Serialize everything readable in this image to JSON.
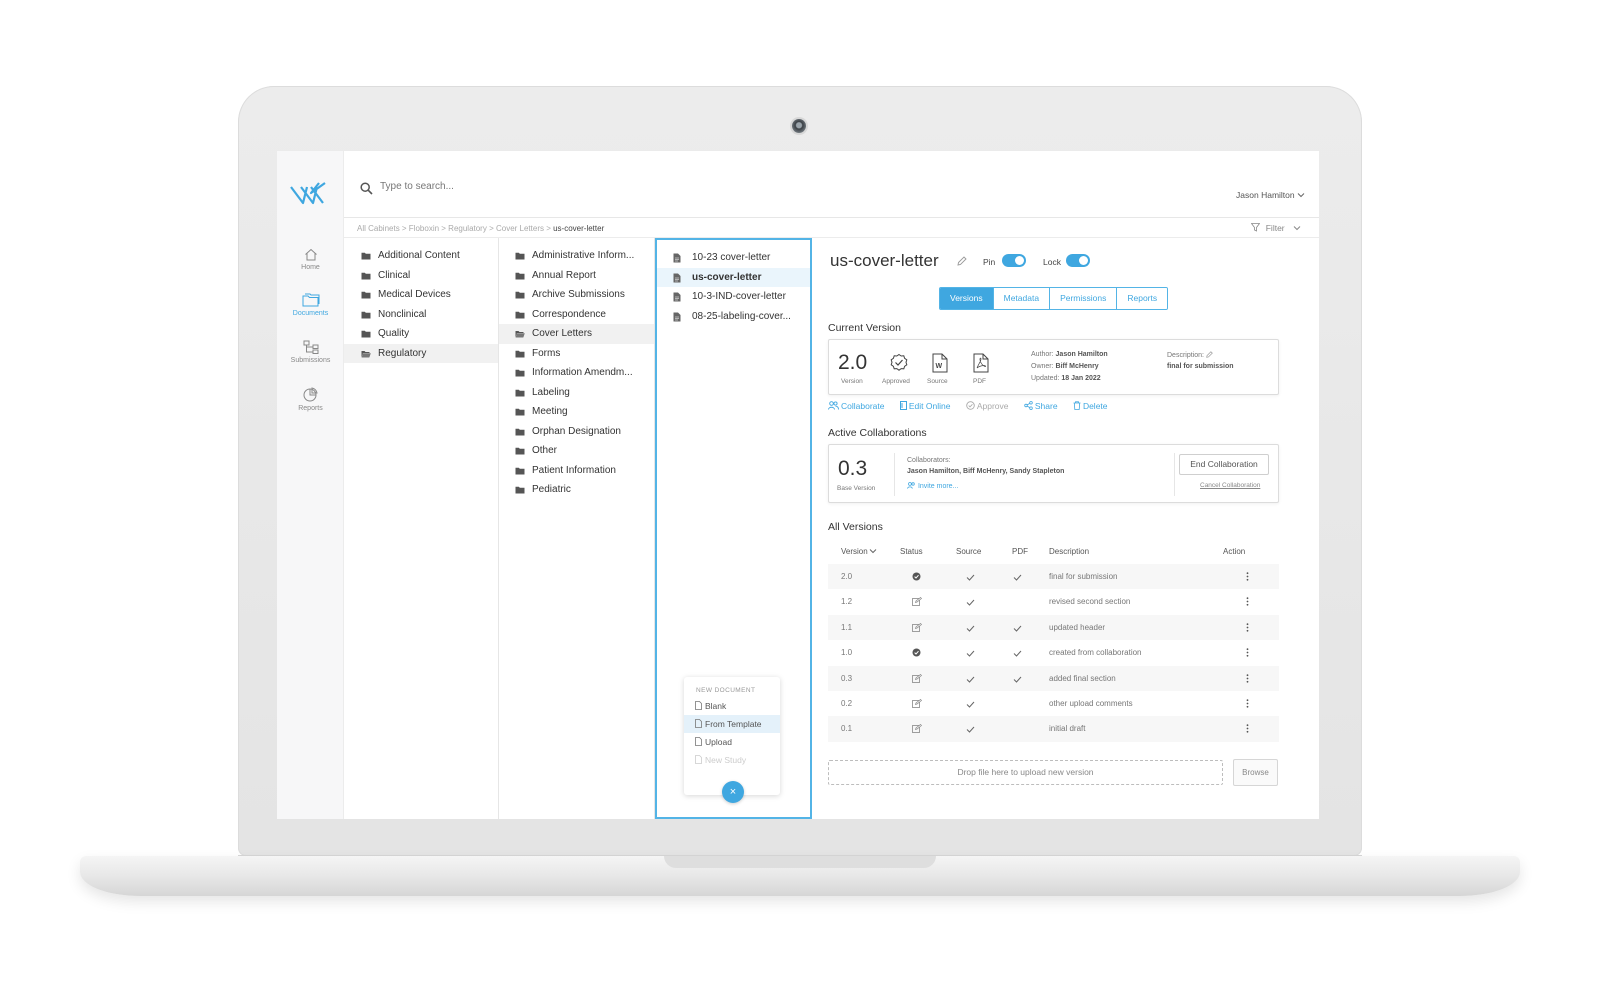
{
  "app": {
    "colors": {
      "accent": "#3fa7e0",
      "text": "#333333",
      "muted": "#888888"
    }
  },
  "nav": {
    "items": [
      {
        "label": "Home",
        "icon": "home-icon"
      },
      {
        "label": "Documents",
        "icon": "folder-icon",
        "active": true
      },
      {
        "label": "Submissions",
        "icon": "tree-icon"
      },
      {
        "label": "Reports",
        "icon": "pie-chart-icon"
      }
    ]
  },
  "search": {
    "placeholder": "Type to search..."
  },
  "user": {
    "name": "Jason Hamilton"
  },
  "breadcrumb": {
    "path": "All Cabinets > Floboxin > Regulatory > Cover Letters > ",
    "current": "us-cover-letter"
  },
  "filter": {
    "label": "Filter"
  },
  "cabinets": [
    "Additional Content",
    "Clinical",
    "Medical Devices",
    "Nonclinical",
    "Quality",
    "Regulatory"
  ],
  "subfolders": [
    "Administrative Inform...",
    "Annual Report",
    "Archive Submissions",
    "Correspondence",
    "Cover Letters",
    "Forms",
    "Information Amendm...",
    "Labeling",
    "Meeting",
    "Orphan Designation",
    "Other",
    "Patient Information",
    "Pediatric"
  ],
  "files": [
    "10-23 cover-letter",
    "us-cover-letter",
    "10-3-IND-cover-letter",
    "08-25-labeling-cover..."
  ],
  "new_document": {
    "header": "NEW DOCUMENT",
    "items": [
      "Blank",
      "From Template",
      "Upload",
      "New Study"
    ],
    "close": "×"
  },
  "detail": {
    "title": "us-cover-letter",
    "pin_label": "Pin",
    "lock_label": "Lock",
    "tabs": [
      "Versions",
      "Metadata",
      "Permissions",
      "Reports"
    ],
    "current_version": {
      "section_title": "Current Version",
      "version": "2.0",
      "version_caption": "Version",
      "approved_caption": "Approved",
      "source_caption": "Source",
      "pdf_caption": "PDF",
      "author_label": "Author:",
      "author": "Jason Hamilton",
      "owner_label": "Owner:",
      "owner": "Biff McHenry",
      "updated_label": "Updated:",
      "updated": "18 Jan 2022",
      "description_label": "Description:",
      "description": "final for submission"
    },
    "actions": [
      "Collaborate",
      "Edit Online",
      "Approve",
      "Share",
      "Delete"
    ],
    "active_collaborations": {
      "section_title": "Active Collaborations",
      "version": "0.3",
      "version_caption": "Base Version",
      "collaborators_label": "Collaborators:",
      "collaborators": "Jason Hamilton, Biff McHenry, Sandy Stapleton",
      "invite": "Invite more...",
      "end_button": "End Collaboration",
      "cancel_link": "Cancel Collaboration"
    },
    "all_versions": {
      "section_title": "All Versions",
      "columns": [
        "Version",
        "Status",
        "Source",
        "PDF",
        "Description",
        "Action"
      ],
      "rows": [
        {
          "version": "2.0",
          "status": "approved",
          "source": true,
          "pdf": true,
          "description": "final for submission"
        },
        {
          "version": "1.2",
          "status": "draft",
          "source": true,
          "pdf": false,
          "description": "revised second section"
        },
        {
          "version": "1.1",
          "status": "draft",
          "source": true,
          "pdf": true,
          "description": " updated header"
        },
        {
          "version": "1.0",
          "status": "approved",
          "source": true,
          "pdf": true,
          "description": "created from collaboration"
        },
        {
          "version": "0.3",
          "status": "draft",
          "source": true,
          "pdf": true,
          "description": "added final section"
        },
        {
          "version": "0.2",
          "status": "draft",
          "source": true,
          "pdf": false,
          "description": "other upload comments"
        },
        {
          "version": "0.1",
          "status": "draft",
          "source": true,
          "pdf": false,
          "description": "initial draft"
        }
      ]
    },
    "dropzone": "Drop file here to upload new version",
    "browse": "Browse"
  }
}
